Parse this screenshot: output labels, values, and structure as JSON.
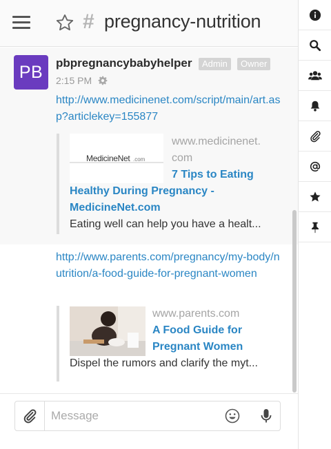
{
  "header": {
    "menu_icon": "hamburger-menu-icon",
    "favorite_icon": "star-outline-icon",
    "hash": "#",
    "channel_name": "pregnancy-nutrition"
  },
  "rail": {
    "items": [
      {
        "icon": "info-icon"
      },
      {
        "icon": "search-icon"
      },
      {
        "icon": "members-icon"
      },
      {
        "icon": "bell-icon"
      },
      {
        "icon": "paperclip-icon"
      },
      {
        "icon": "mention-icon"
      },
      {
        "icon": "star-icon"
      },
      {
        "icon": "pin-icon"
      }
    ]
  },
  "message": {
    "avatar_initials": "PB",
    "avatar_color": "#6a3bbf",
    "username": "pbpregnancybabyhelper",
    "badges": [
      "Admin",
      "Owner"
    ],
    "time": "2:15 PM",
    "link1": "http://www.medicinenet.com/script/main/art.asp?articlekey=155877",
    "preview1": {
      "thumb_text": "MedicineNet",
      "thumb_suffix": ".com",
      "domain_line1": "www.medicinenet.",
      "domain_line2": "com",
      "title_line1": "7 Tips to Eating",
      "title_line2": "Healthy During Pregnancy -",
      "title_line3": "MedicineNet.com",
      "description": "Eating well can help you have a healt..."
    },
    "link2": "http://www.parents.com/pregnancy/my-body/nutrition/a-food-guide-for-pregnant-women",
    "preview2": {
      "domain": "www.parents.com",
      "title_line1": "A Food Guide for",
      "title_line2": "Pregnant Women",
      "description": "Dispel the rumors and clarify the myt..."
    }
  },
  "composer": {
    "placeholder": "Message",
    "value": "",
    "attach_icon": "paperclip-icon",
    "emoji_icon": "smiley-icon",
    "mic_icon": "microphone-icon"
  },
  "colors": {
    "link": "#2a86c4",
    "badge": "#d4d4d4"
  }
}
